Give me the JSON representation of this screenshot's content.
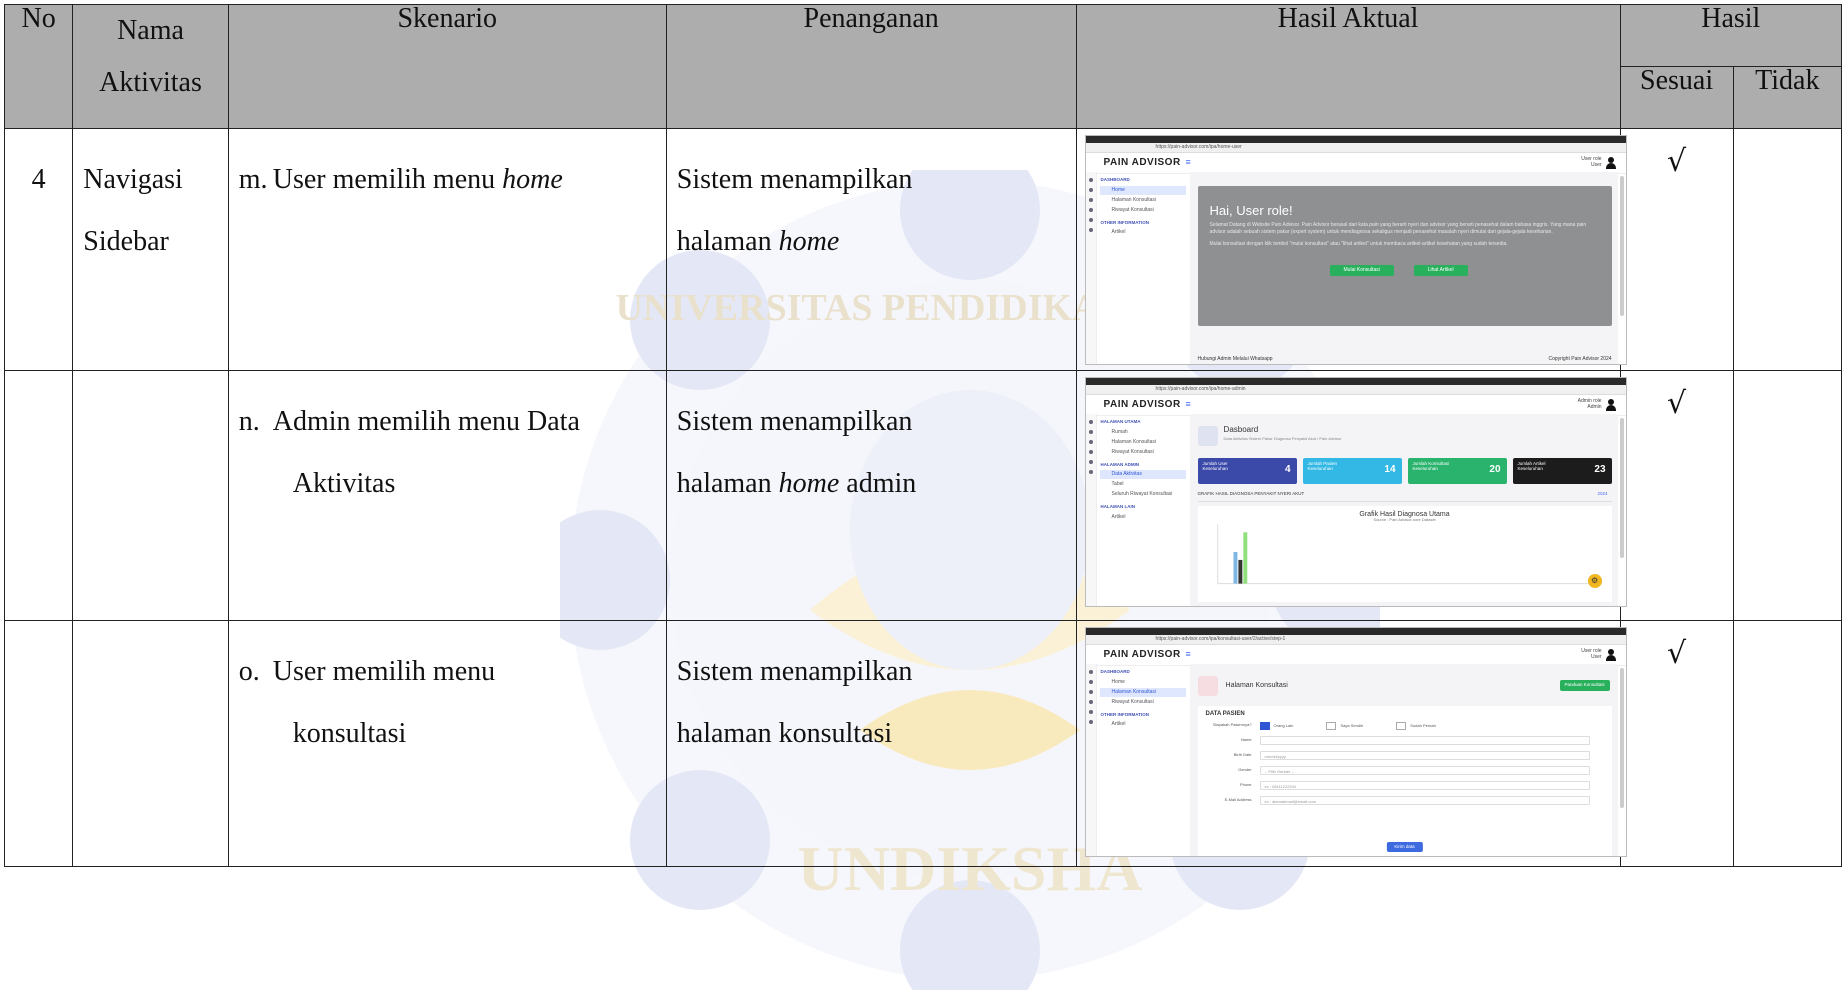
{
  "table": {
    "headers": {
      "no": "No",
      "nama_line1": "Nama",
      "nama_line2": "Aktivitas",
      "skenario": "Skenario",
      "penanganan": "Penanganan",
      "hasil_aktual": "Hasil Aktual",
      "hasil": "Hasil",
      "sesuai": "Sesuai",
      "tidak": "Tidak"
    },
    "rows": [
      {
        "no": "4",
        "nama_line1": "Navigasi",
        "nama_line2": "Sidebar",
        "letter": "m.",
        "skenario_pre": "User memilih menu ",
        "skenario_em": "home",
        "skenario_line2": "",
        "penanganan_line1": "Sistem menampilkan",
        "penanganan_pre": "halaman ",
        "penanganan_em": "home",
        "penanganan_post": "",
        "sesuai": "√",
        "tidak": ""
      },
      {
        "no": "",
        "nama_line1": "",
        "nama_line2": "",
        "letter": "n.",
        "skenario_pre": "Admin memilih menu Data",
        "skenario_em": "",
        "skenario_line2": "Aktivitas",
        "penanganan_line1": "Sistem menampilkan",
        "penanganan_pre": "halaman ",
        "penanganan_em": "home",
        "penanganan_post": " admin",
        "sesuai": "√",
        "tidak": ""
      },
      {
        "no": "",
        "nama_line1": "",
        "nama_line2": "",
        "letter": "o.",
        "skenario_pre": "User memilih menu",
        "skenario_em": "",
        "skenario_line2": "konsultasi",
        "penanganan_line1": "Sistem menampilkan",
        "penanganan_pre": "halaman konsultasi",
        "penanganan_em": "",
        "penanganan_post": "",
        "sesuai": "√",
        "tidak": ""
      }
    ]
  },
  "shots": {
    "common": {
      "brand": "PAIN ADVISOR",
      "ham": "≡"
    },
    "s1": {
      "user_role": "User role",
      "user_name": "User",
      "sections": [
        {
          "title": "DASHBOARD",
          "items": [
            "Home",
            "Halaman Konsultasi",
            "Riwayat Konsultasi"
          ],
          "active": 0
        },
        {
          "title": "OTHER INFORMATION",
          "items": [
            "Artikel"
          ],
          "active": -1
        }
      ],
      "heading": "Hai, User role!",
      "paragraph": "Selamat Datang di Website Pain Advisor. Pain Advisor berasal dari kata pain yang berarti nyeri dan advisor yang berarti penasehat dalam bahasa inggris. Yang mana pain advisor adalah sebuah sistem pakar (expert system) untuk mendiagnosa sekaligus menjadi penasehat masalah nyeri dimulai dari gejala-gejala keseharian.",
      "paragraph2": "Mulai konsultasi dengan klik tombol \"mulai konsultasi\" atau \"lihat artikel\" untuk membaca artikel-artikel kesehatan yang sudah tersedia.",
      "btn1": "Mulai Konsultasi",
      "btn2": "Lihat Artikel",
      "footer_left": "Hubungi Admin Melalui Whatsapp",
      "footer_right": "Copyright Pain Advisor 2024"
    },
    "s2": {
      "user_role": "Admin role",
      "user_name": "Admin",
      "sections": [
        {
          "title": "HALAMAN UTAMA",
          "items": [
            "Rumah",
            "Halaman Konsultasi",
            "Riwayat Konsultasi"
          ],
          "active": -1
        },
        {
          "title": "HALAMAN ADMIN",
          "items": [
            "Data Aktivitas",
            "Tabel",
            "Seluruh Riwayat Konsultasi"
          ],
          "active": 0
        },
        {
          "title": "HALAMAN LAIN",
          "items": [
            "Artikel"
          ],
          "active": -1
        }
      ],
      "title": "Dasboard",
      "subtitle": "Data Aktivitas Sistem Pakar Diagnosa Penyakit Akut / Pain Advisor",
      "stats": [
        {
          "label": "Jumlah User",
          "sub": "Keseluruhan",
          "value": "4",
          "color": "#3b4aa8"
        },
        {
          "label": "Jumlah Pasien",
          "sub": "Keseluruhan",
          "value": "14",
          "color": "#33b8e6"
        },
        {
          "label": "Jumlah Konsultasi",
          "sub": "Keseluruhan",
          "value": "20",
          "color": "#2ab36d"
        },
        {
          "label": "Jumlah Artikel",
          "sub": "Keseluruhan",
          "value": "23",
          "color": "#1c1c1c"
        }
      ],
      "graph_title": "GRAFIK HASIL DIAGNOSA PENYAKIT NYERI AKUT",
      "graph_year": "2024",
      "chart_title": "Grafik Hasil Diagnosa Utama",
      "chart_sub": "Source : Pain Advisor-core Dataset",
      "gear": "⚙"
    },
    "s3": {
      "user_role": "User role",
      "user_name": "User",
      "sections": [
        {
          "title": "DASHBOARD",
          "items": [
            "Home",
            "Halaman Konsultasi",
            "Riwayat Konsultasi"
          ],
          "active": 1
        },
        {
          "title": "OTHER INFORMATION",
          "items": [
            "Artikel"
          ],
          "active": -1
        }
      ],
      "title": "Halaman Konsultasi",
      "btn": "Panduan Konsultasi",
      "section": "DATA PASIEN",
      "q_label": "Siapakah Pasiennya?",
      "radios": [
        "Orang Lain",
        "Saya Sendiri",
        "Sudah Pernah"
      ],
      "fields": [
        {
          "label": "Name",
          "placeholder": ""
        },
        {
          "label": "Birth Date",
          "placeholder": "mm/dd/yyyy"
        },
        {
          "label": "Gender",
          "placeholder": "-- Pilih Gender --"
        },
        {
          "label": "Phone",
          "placeholder": "ex : 08111222334"
        },
        {
          "label": "E-Mail Address",
          "placeholder": "ex : alamatemail@email.com"
        }
      ],
      "submit": "Kirim data"
    }
  },
  "watermark": {
    "top_text": "UNIVERSITAS PENDIDIKAN GANESHA",
    "bottom_text": "UNDIKSHA"
  }
}
